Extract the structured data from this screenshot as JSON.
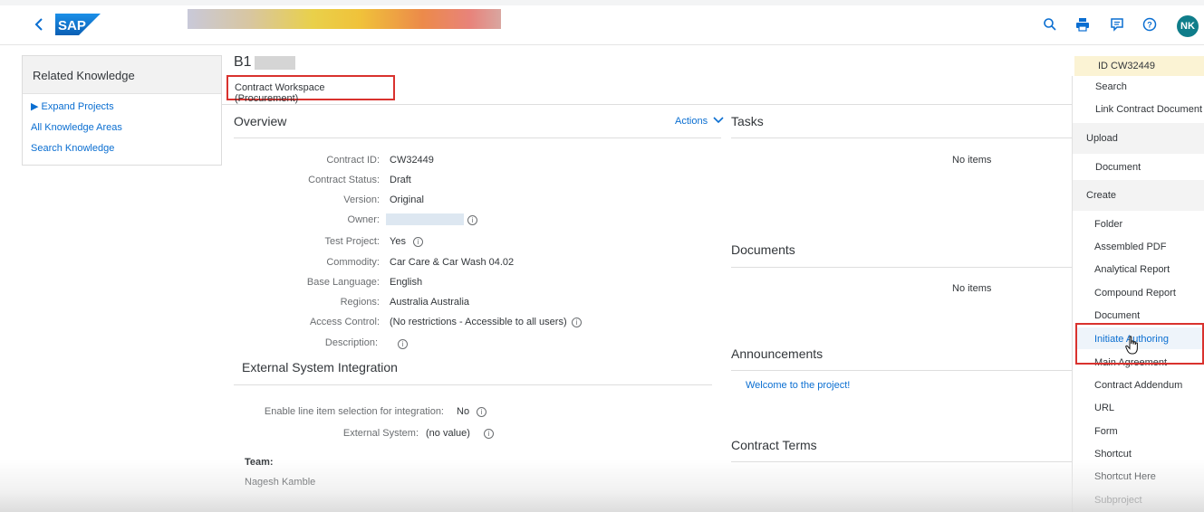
{
  "shell": {
    "logo_text": "SAP",
    "avatar_initials": "NK",
    "icons": [
      "search-icon",
      "printer-icon",
      "feedback-icon",
      "help-icon"
    ],
    "colors": {
      "accent": "#0a6ed1",
      "avatar": "#0f7d8a",
      "highlight_border": "#d9322e",
      "id_box": "#fbf3d4"
    }
  },
  "sidebar": {
    "title": "Related Knowledge",
    "items": [
      {
        "label": "▶ Expand Projects"
      },
      {
        "label": "All Knowledge Areas"
      },
      {
        "label": "Search Knowledge"
      }
    ]
  },
  "header": {
    "title": "B1",
    "workspace_type": "Contract Workspace (Procurement)"
  },
  "overview": {
    "title": "Overview",
    "actions_label": "Actions",
    "fields": [
      {
        "label": "Contract ID:",
        "value": "CW32449"
      },
      {
        "label": "Contract Status:",
        "value": "Draft"
      },
      {
        "label": "Version:",
        "value": "Original"
      },
      {
        "label": "Owner:",
        "value": ""
      },
      {
        "label": "Test Project:",
        "value": "Yes"
      },
      {
        "label": "Commodity:",
        "value": "Car Care & Car Wash 04.02"
      },
      {
        "label": "Base Language:",
        "value": "English"
      },
      {
        "label": "Regions:",
        "value": "Australia Australia"
      },
      {
        "label": "Access Control:",
        "value": "(No restrictions - Accessible to all users)"
      },
      {
        "label": "Description:",
        "value": ""
      }
    ]
  },
  "external": {
    "title": "External System Integration",
    "fields": [
      {
        "label": "Enable line item selection for integration:",
        "value": "No"
      },
      {
        "label": "External System:",
        "value": "(no value)"
      }
    ],
    "team_label": "Team:",
    "team_member": "Nagesh Kamble"
  },
  "tasks": {
    "title": "Tasks",
    "empty": "No items"
  },
  "documents": {
    "title": "Documents",
    "empty": "No items"
  },
  "announcements": {
    "title": "Announcements",
    "link": "Welcome to the project!"
  },
  "contract_terms": {
    "title": "Contract Terms"
  },
  "right_panel": {
    "id_label": "ID CW32449",
    "items": [
      {
        "label": "Search",
        "kind": "item"
      },
      {
        "label": "Link Contract Document",
        "kind": "item"
      },
      {
        "label": "Upload",
        "kind": "group"
      },
      {
        "label": "Document",
        "kind": "item"
      },
      {
        "label": "Create",
        "kind": "group"
      },
      {
        "label": "Folder",
        "kind": "item"
      },
      {
        "label": "Assembled PDF",
        "kind": "item"
      },
      {
        "label": "Analytical Report",
        "kind": "item"
      },
      {
        "label": "Compound Report",
        "kind": "item"
      },
      {
        "label": "Document",
        "kind": "item"
      },
      {
        "label": "Initiate Authoring",
        "kind": "item",
        "selected": true
      },
      {
        "label": "Main Agreement",
        "kind": "item"
      },
      {
        "label": "Contract Addendum",
        "kind": "item"
      },
      {
        "label": "URL",
        "kind": "item"
      },
      {
        "label": "Form",
        "kind": "item"
      },
      {
        "label": "Shortcut",
        "kind": "item"
      },
      {
        "label": "Shortcut Here",
        "kind": "item"
      },
      {
        "label": "Subproject",
        "kind": "item"
      }
    ]
  }
}
